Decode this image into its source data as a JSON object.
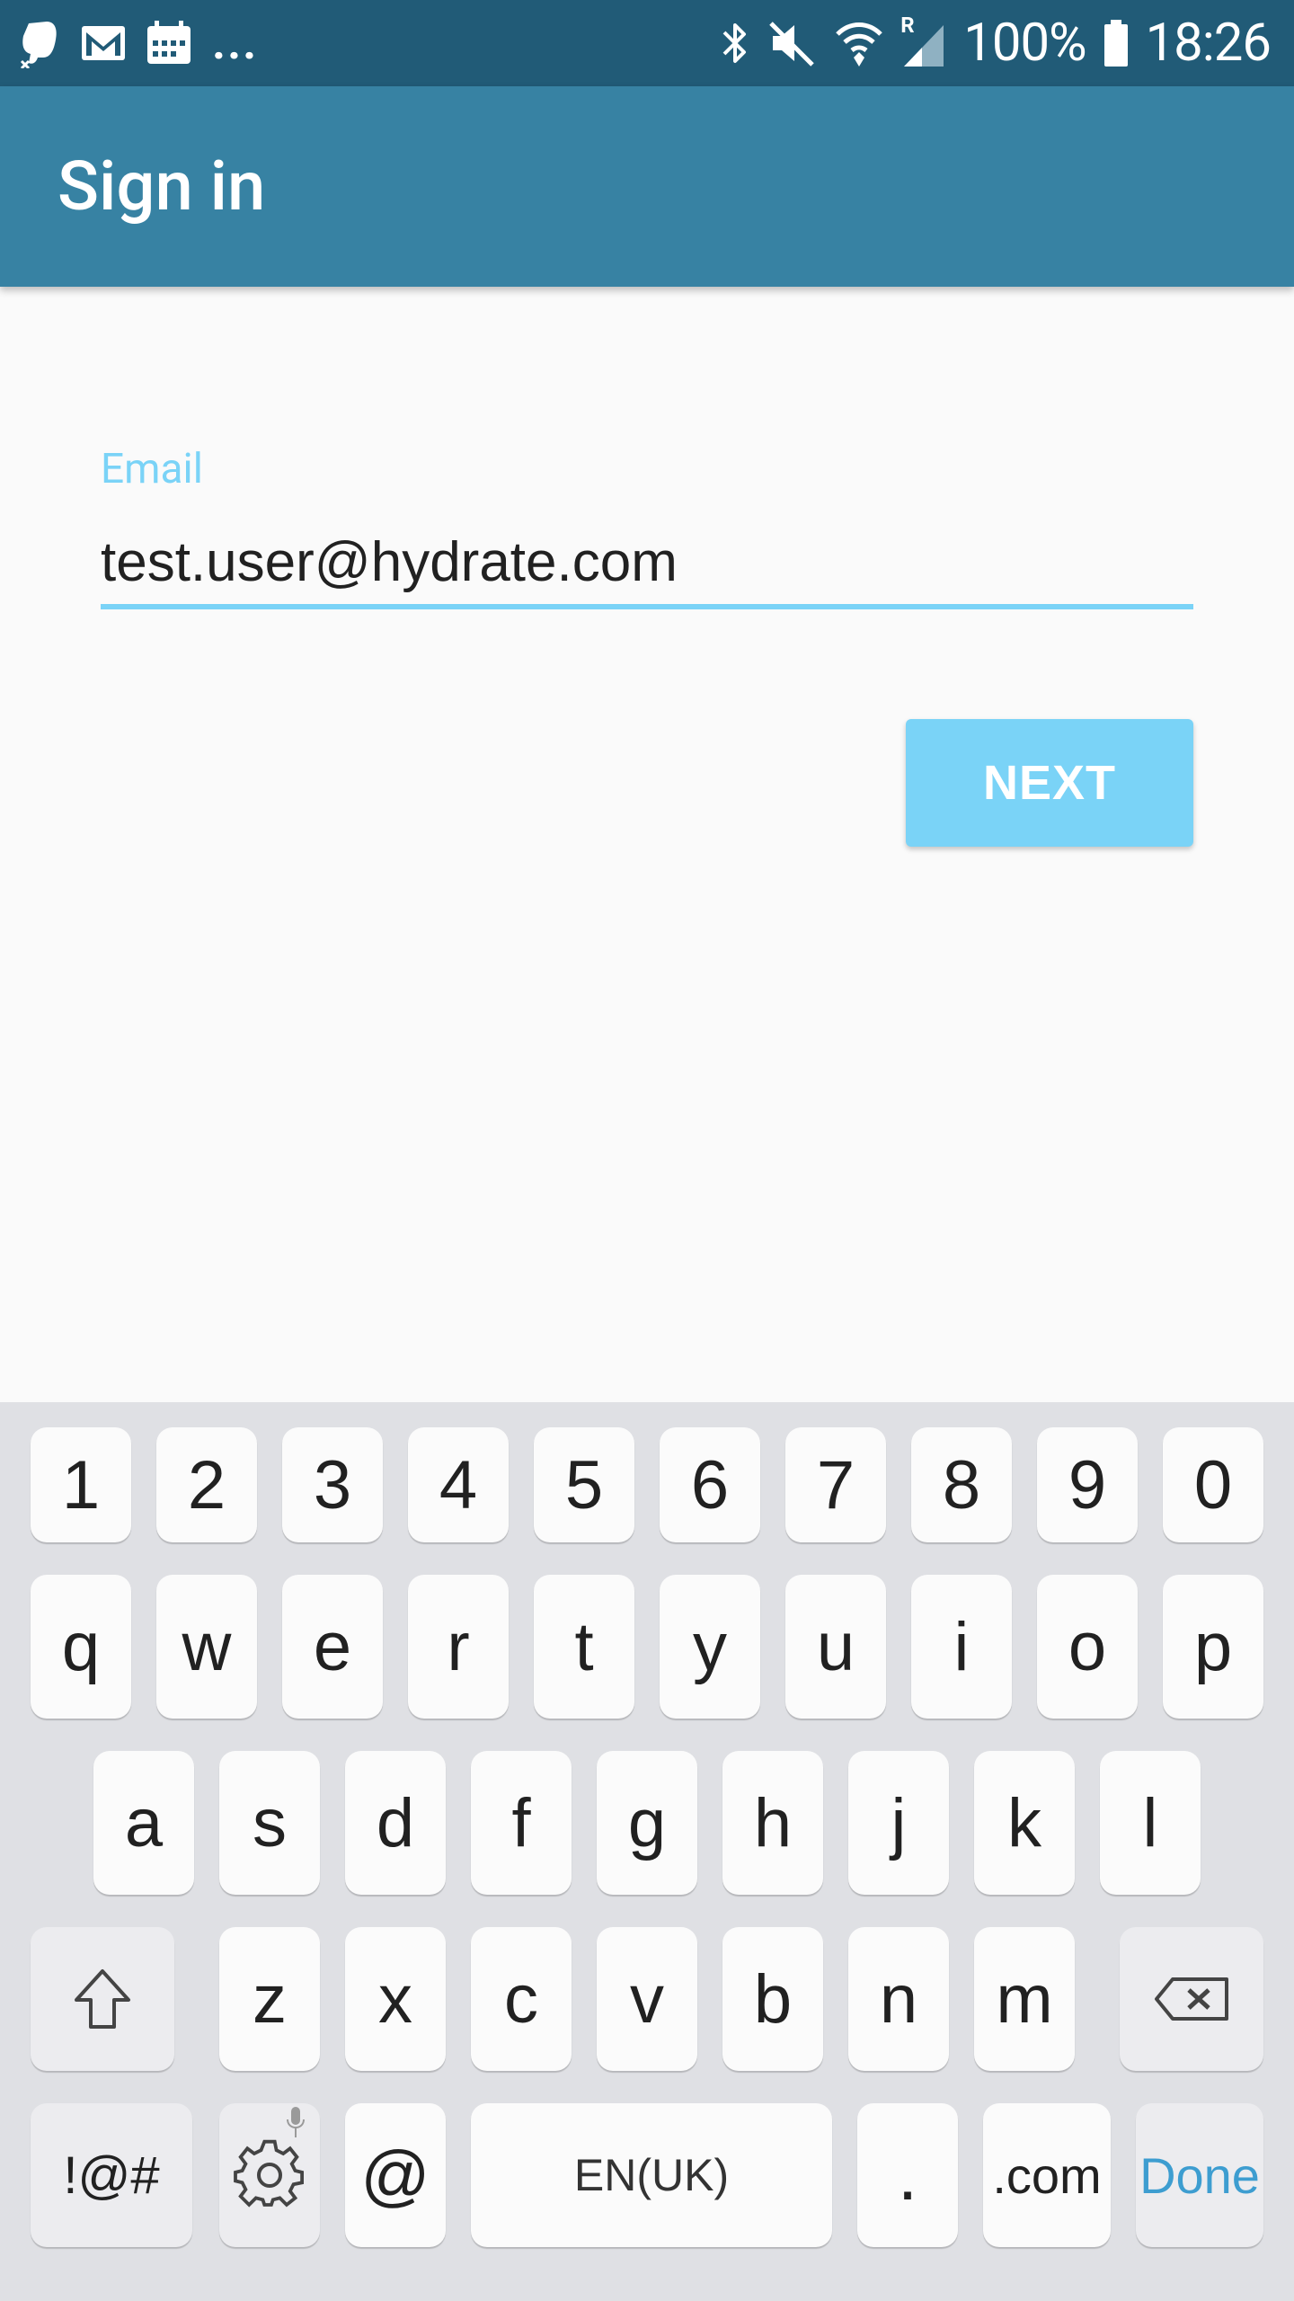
{
  "status_bar": {
    "left_icons": [
      "evernote-icon",
      "gmail-icon",
      "calendar-icon"
    ],
    "more_indicator": "...",
    "right_icons": [
      "bluetooth-icon",
      "mute-icon",
      "wifi-icon",
      "signal-icon",
      "battery-icon"
    ],
    "roaming_label": "R",
    "battery_percent": "100%",
    "time": "18:26"
  },
  "app_bar": {
    "title": "Sign in"
  },
  "form": {
    "email_label": "Email",
    "email_value": "test.user@hydrate.com",
    "next_label": "NEXT"
  },
  "keyboard": {
    "row_numbers": [
      "1",
      "2",
      "3",
      "4",
      "5",
      "6",
      "7",
      "8",
      "9",
      "0"
    ],
    "row_top": [
      "q",
      "w",
      "e",
      "r",
      "t",
      "y",
      "u",
      "i",
      "o",
      "p"
    ],
    "row_middle": [
      "a",
      "s",
      "d",
      "f",
      "g",
      "h",
      "j",
      "k",
      "l"
    ],
    "row_bottom": [
      "z",
      "x",
      "c",
      "v",
      "b",
      "n",
      "m"
    ],
    "symbols_label": "!@#",
    "at_label": "@",
    "space_label": "EN(UK)",
    "period_label": ".",
    "dotcom_label": ".com",
    "done_label": "Done"
  },
  "colors": {
    "status_bar": "#215b77",
    "app_bar": "#3782a3",
    "accent": "#7ad3f7",
    "done_text": "#3d9dd0"
  }
}
